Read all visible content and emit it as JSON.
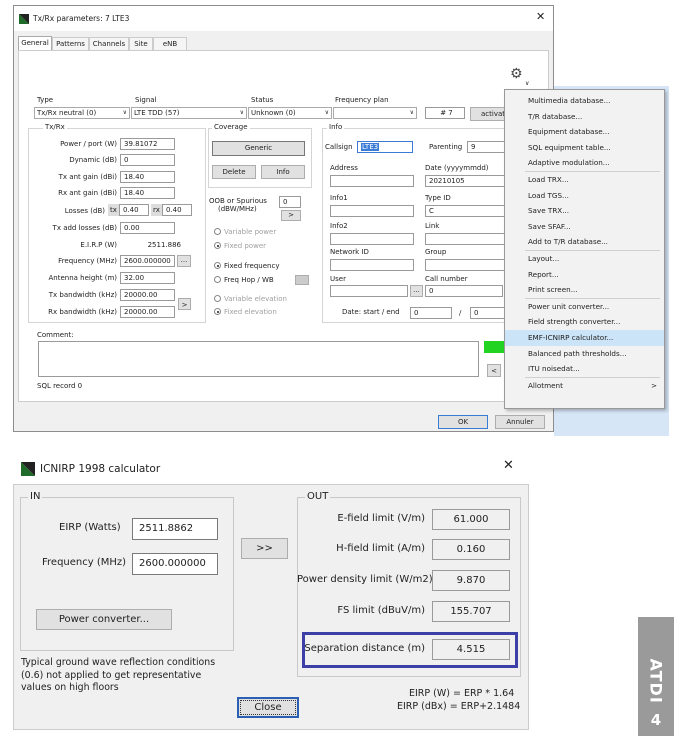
{
  "tx": {
    "title": "Tx/Rx parameters: 7 LTE3",
    "tabs": [
      "General",
      "Patterns",
      "Channels",
      "Site",
      "eNB"
    ],
    "top_labels": {
      "type": "Type",
      "signal": "Signal",
      "status": "Status",
      "freqplan": "Frequency plan"
    },
    "type_value": "Tx/Rx neutral (0)",
    "signal_value": "LTE TDD (57)",
    "status_value": "Unknown (0)",
    "freqplan_value": "",
    "plan_number": "# 7",
    "activate_label": "activat",
    "txrx_group": "Tx/Rx",
    "fields": [
      {
        "label": "Power / port (W)",
        "value": "39.81072"
      },
      {
        "label": "Dynamic (dB)",
        "value": "0"
      },
      {
        "label": "Tx ant gain (dBi)",
        "value": "18.40"
      },
      {
        "label": "Rx ant gain (dBi)",
        "value": "18.40"
      }
    ],
    "losses_label": "Losses (dB)",
    "losses_tx_tag": "tx",
    "losses_tx": "0.40",
    "losses_rx_tag": "rx",
    "losses_rx": "0.40",
    "add_losses_label": "Tx add losses (dB)",
    "add_losses": "0.00",
    "eirp_label": "E.I.R.P (W)",
    "eirp_value": "2511.886",
    "frequency_label": "Frequency (MHz)",
    "frequency_value": "2600.000000",
    "ellipsis": "...",
    "antenna_label": "Antenna height (m)",
    "antenna_value": "32.00",
    "txbw_label": "Tx bandwidth (kHz)",
    "txbw_value": "20000.00",
    "rxbw_label": "Rx bandwidth (kHz)",
    "rxbw_value": "20000.00",
    "arrow_btn": ">",
    "coverage_group": "Coverage",
    "coverage_generic": "Generic",
    "delete_btn": "Delete",
    "info_btn": "Info",
    "oob_label": "OOB or Spurious",
    "oob_unit": "(dBW/MHz)",
    "oob_value": "0",
    "variable_power": "Variable power",
    "fixed_power": "Fixed power",
    "fixed_frequency": "Fixed frequency",
    "freq_hop": "Freq Hop / WB",
    "variable_elevation": "Variable elevation",
    "fixed_elevation": "Fixed elevation",
    "info_group": "Info",
    "callsign_label": "Callsign",
    "callsign_value": "LTE3",
    "parenting_label": "Parenting",
    "parenting_value": "9",
    "address_label": "Address",
    "date_label": "Date (yyyymmdd)",
    "date_value": "20210105",
    "info1_label": "Info1",
    "typeid_label": "Type ID",
    "typeid_value": "C",
    "info2_label": "Info2",
    "link_label": "Link",
    "network_label": "Network ID",
    "group_label": "Group",
    "user_label": "User",
    "callnumber_label": "Call number",
    "callnumber_value": "0",
    "datestart_label": "Date: start / end",
    "date_start": "0",
    "date_sep": "/",
    "date_end": "0",
    "comment_label": "Comment:",
    "sql_record": "SQL record 0",
    "scroll_left": "<",
    "ok_btn": "OK",
    "cancel_btn": "Annuler"
  },
  "menu": {
    "items": [
      "Multimedia database...",
      "T/R database...",
      "Equipment database...",
      "SQL equipment table...",
      "Adaptive modulation...",
      "Load TRX...",
      "Load TGS...",
      "Save TRX...",
      "Save SFAF...",
      "Add to T/R database...",
      "Layout...",
      "Report...",
      "Print screen...",
      "Power unit converter...",
      "Field strength converter...",
      "EMF-ICNIRP calculator...",
      "Balanced path thresholds...",
      "ITU noisedat...",
      "Allotment"
    ],
    "highlighted": "EMF-ICNIRP calculator...",
    "submenu_arrow": ">"
  },
  "calc": {
    "title": "ICNIRP 1998 calculator",
    "in_group": "IN",
    "out_group": "OUT",
    "eirp_label": "EIRP (Watts)",
    "eirp_value": "2511.8862",
    "frequency_label": "Frequency (MHz)",
    "frequency_value": "2600.000000",
    "compute_btn": ">>",
    "power_converter_btn": "Power converter...",
    "note": "Typical ground wave reflection conditions (0.6) not applied to get representative values on high floors",
    "outputs": [
      {
        "label": "E-field limit (V/m)",
        "value": "61.000"
      },
      {
        "label": "H-field limit (A/m)",
        "value": "0.160"
      },
      {
        "label": "Power density limit (W/m2)",
        "value": "9.870"
      },
      {
        "label": "FS limit (dBuV/m)",
        "value": "155.707"
      },
      {
        "label": "Separation distance (m)",
        "value": "4.515"
      }
    ],
    "formula1": "EIRP (W) = ERP * 1.64",
    "formula2": "EIRP (dBx) = ERP+2.1484",
    "close_btn": "Close",
    "highlight_color": "#3b3fa6"
  },
  "badge": {
    "text": "ATDI",
    "number": "4"
  }
}
